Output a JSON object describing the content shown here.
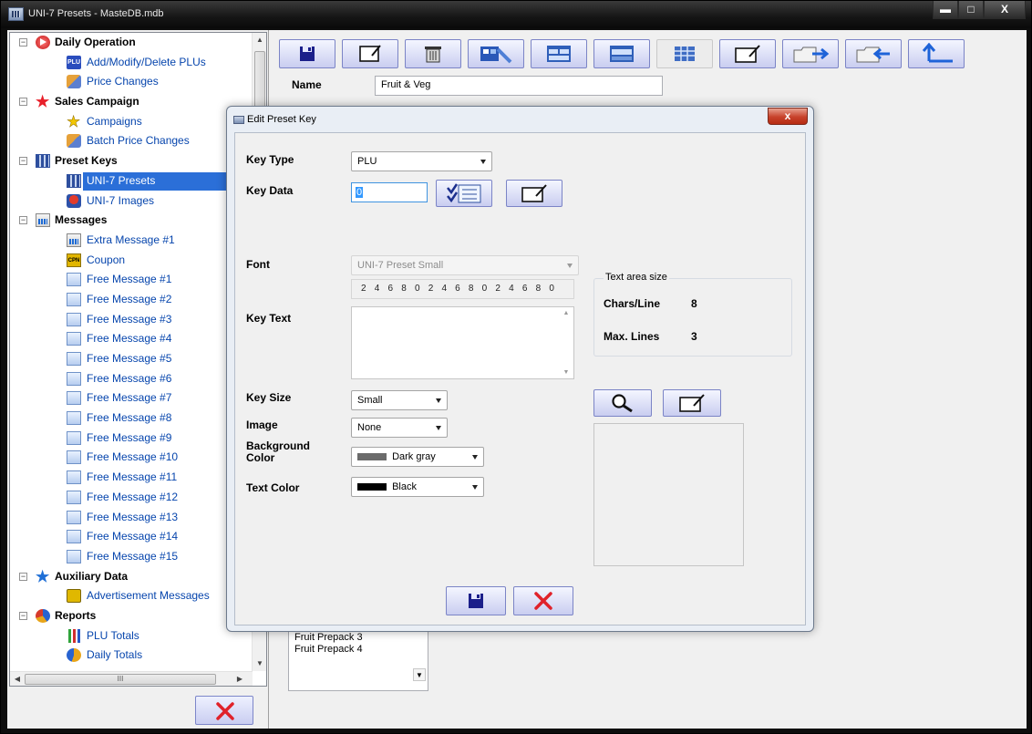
{
  "window": {
    "title": "UNI-7 Presets - MasteDB.mdb",
    "controls": {
      "minimize": "▬",
      "maximize": "□",
      "close": "X"
    }
  },
  "tree": {
    "groups": [
      {
        "label": "Daily Operation",
        "icon": "daily-operation-icon",
        "items": [
          {
            "label": "Add/Modify/Delete PLUs",
            "icon": "plu-icon"
          },
          {
            "label": "Price Changes",
            "icon": "price-changes-icon"
          }
        ]
      },
      {
        "label": "Sales Campaign",
        "icon": "red-star-icon",
        "items": [
          {
            "label": "Campaigns",
            "icon": "yellow-star-icon"
          },
          {
            "label": "Batch Price Changes",
            "icon": "batch-price-icon"
          }
        ]
      },
      {
        "label": "Preset Keys",
        "icon": "preset-keys-icon",
        "items": [
          {
            "label": "UNI-7 Presets",
            "icon": "presets-icon",
            "selected": true
          },
          {
            "label": "UNI-7 Images",
            "icon": "images-icon"
          }
        ]
      },
      {
        "label": "Messages",
        "icon": "messages-icon",
        "items": [
          {
            "label": "Extra Message #1",
            "icon": "extra-message-icon"
          },
          {
            "label": "Coupon",
            "icon": "coupon-icon"
          },
          {
            "label": "Free Message #1",
            "icon": "free-message-icon"
          },
          {
            "label": "Free Message #2",
            "icon": "free-message-icon"
          },
          {
            "label": "Free Message #3",
            "icon": "free-message-icon"
          },
          {
            "label": "Free Message #4",
            "icon": "free-message-icon"
          },
          {
            "label": "Free Message #5",
            "icon": "free-message-icon"
          },
          {
            "label": "Free Message #6",
            "icon": "free-message-icon"
          },
          {
            "label": "Free Message #7",
            "icon": "free-message-icon"
          },
          {
            "label": "Free Message #8",
            "icon": "free-message-icon"
          },
          {
            "label": "Free Message #9",
            "icon": "free-message-icon"
          },
          {
            "label": "Free Message #10",
            "icon": "free-message-icon"
          },
          {
            "label": "Free Message #11",
            "icon": "free-message-icon"
          },
          {
            "label": "Free Message #12",
            "icon": "free-message-icon"
          },
          {
            "label": "Free Message #13",
            "icon": "free-message-icon"
          },
          {
            "label": "Free Message #14",
            "icon": "free-message-icon"
          },
          {
            "label": "Free Message #15",
            "icon": "free-message-icon"
          }
        ]
      },
      {
        "label": "Auxiliary Data",
        "icon": "blue-star-icon",
        "items": [
          {
            "label": "Advertisement Messages",
            "icon": "advertisement-icon"
          }
        ]
      },
      {
        "label": "Reports",
        "icon": "reports-icon",
        "items": [
          {
            "label": "PLU Totals",
            "icon": "plu-totals-icon"
          },
          {
            "label": "Daily Totals",
            "icon": "daily-totals-icon"
          }
        ]
      }
    ],
    "expander_symbol": "−",
    "hscroll_thumb_grip": "III"
  },
  "toolbar": {
    "buttons": [
      "save-icon",
      "edit-icon",
      "delete-icon",
      "key-layout-icon",
      "layout-a-icon",
      "layout-b-icon",
      "grid-icon",
      "edit-window-icon",
      "export-folder-icon",
      "import-folder-icon",
      "back-arrow-icon"
    ]
  },
  "main": {
    "name_label": "Name",
    "name_value": "Fruit & Veg",
    "list_items": [
      "Fruit Prepack 3",
      "Fruit Prepack 4"
    ]
  },
  "dialog": {
    "title": "Edit Preset Key",
    "close_label": "x",
    "key_type_label": "Key Type",
    "key_type_value": "PLU",
    "key_data_label": "Key Data",
    "key_data_value": "0",
    "font_label": "Font",
    "font_value": "UNI-7 Preset Small",
    "ruler": "2 4 6 8 0 2 4 6 8 0 2 4 6 8 0",
    "key_text_label": "Key Text",
    "key_text_value": "",
    "text_area_group": {
      "title": "Text area size",
      "chars_per_line_label": "Chars/Line",
      "chars_per_line_value": "8",
      "max_lines_label": "Max. Lines",
      "max_lines_value": "3"
    },
    "key_size_label": "Key Size",
    "key_size_value": "Small",
    "image_label": "Image",
    "image_value": "None",
    "background_color_label_1": "Background",
    "background_color_label_2": "Color",
    "background_color_value": "Dark gray",
    "background_color_hex": "#6b6b6b",
    "text_color_label": "Text Color",
    "text_color_value": "Black",
    "text_color_hex": "#000000"
  },
  "colors": {
    "selection": "#2b6fd8",
    "button_border": "#7b84c6",
    "cancel_x": "#e0222a",
    "save_icon": "#1b1f8a"
  }
}
